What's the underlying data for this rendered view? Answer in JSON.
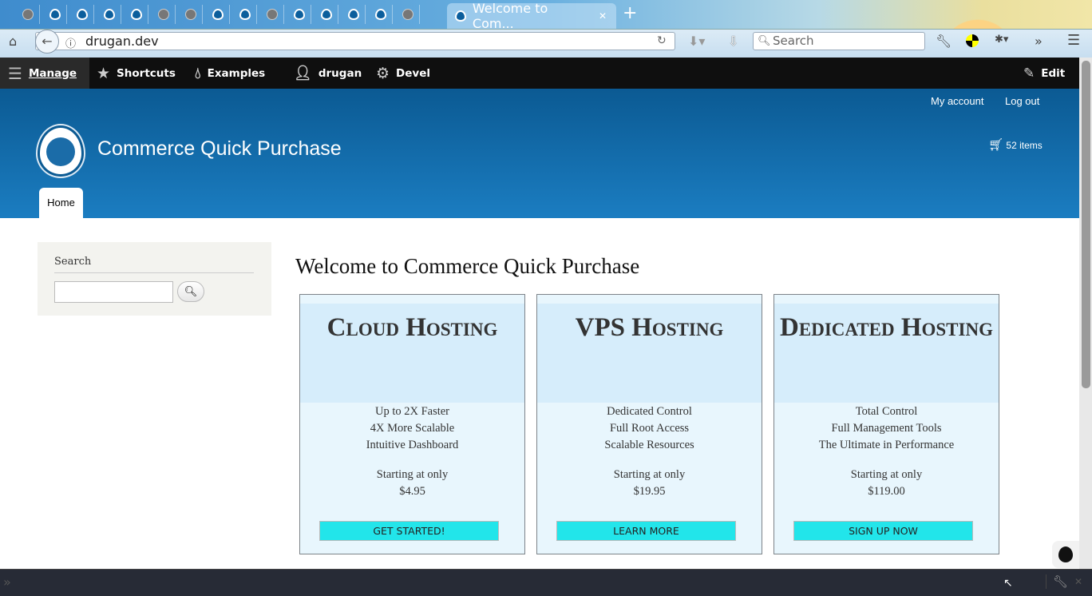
{
  "browser": {
    "active_tab_title": "Welcome to Com...",
    "url": "drugan.dev",
    "search_placeholder": "Search",
    "background_tabs": [
      "globe",
      "drupal",
      "drupal",
      "drupal",
      "drupal",
      "globe",
      "globe",
      "drupal",
      "drupal",
      "globe",
      "drupal",
      "drupal",
      "drupal",
      "drupal",
      "globe"
    ]
  },
  "toolbar": {
    "manage": "Manage",
    "shortcuts": "Shortcuts",
    "examples": "Examples",
    "user": "drugan",
    "devel": "Devel",
    "edit": "Edit"
  },
  "header": {
    "my_account": "My account",
    "log_out": "Log out",
    "site_name": "Commerce Quick Purchase",
    "cart": "52 items",
    "home_tab": "Home"
  },
  "sidebar": {
    "search_title": "Search",
    "search_value": ""
  },
  "main": {
    "title": "Welcome to Commerce Quick Purchase",
    "cards": [
      {
        "heading": "Cloud Hosting",
        "features": [
          "Up to 2X Faster",
          "4X More Scalable",
          "Intuitive Dashboard"
        ],
        "price_label": "Starting at only",
        "price": "$4.95",
        "button": "GET STARTED!"
      },
      {
        "heading": "VPS Hosting",
        "features": [
          "Dedicated Control",
          "Full Root Access",
          "Scalable Resources"
        ],
        "price_label": "Starting at only",
        "price": "$19.95",
        "button": "LEARN MORE"
      },
      {
        "heading": "Dedicated Hosting",
        "features": [
          "Total Control",
          "Full Management Tools",
          "The Ultimate in Performance"
        ],
        "price_label": "Starting at only",
        "price": "$119.00",
        "button": "SIGN UP NOW"
      }
    ]
  },
  "colors": {
    "header_blue": "#1b7dc1",
    "button_cyan": "#22e5ea",
    "card_bg": "#e8f6fd"
  }
}
